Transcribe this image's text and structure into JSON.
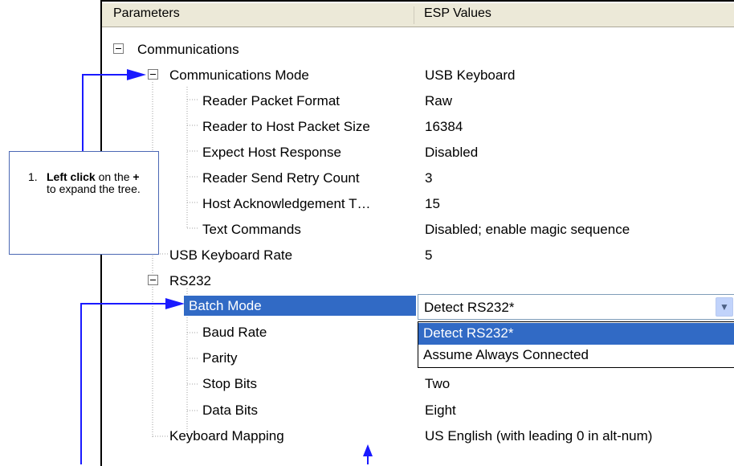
{
  "header": {
    "col_parameters": "Parameters",
    "col_values": "ESP Values"
  },
  "tree": {
    "communications": "Communications",
    "comm_mode": {
      "label": "Communications Mode",
      "value": "USB Keyboard"
    },
    "reader_packet_format": {
      "label": "Reader Packet Format",
      "value": "Raw"
    },
    "reader_host_packet_size": {
      "label": "Reader to Host Packet Size",
      "value": "16384"
    },
    "expect_host_response": {
      "label": "Expect Host Response",
      "value": "Disabled"
    },
    "reader_send_retry": {
      "label": "Reader Send Retry Count",
      "value": "3"
    },
    "host_ack": {
      "label": "Host Acknowledgement T…",
      "value": "15"
    },
    "text_commands": {
      "label": "Text Commands",
      "value": "Disabled; enable magic sequence"
    },
    "usb_keyboard_rate": {
      "label": "USB Keyboard Rate",
      "value": "5"
    },
    "rs232": "RS232",
    "batch_mode": {
      "label": "Batch Mode",
      "value": "Detect RS232*"
    },
    "baud_rate": {
      "label": "Baud Rate"
    },
    "parity": {
      "label": "Parity"
    },
    "stop_bits": {
      "label": "Stop Bits",
      "value": "Two"
    },
    "data_bits": {
      "label": "Data Bits",
      "value": "Eight"
    },
    "keyboard_mapping": {
      "label": "Keyboard Mapping",
      "value": "US English (with leading 0 in alt-num)"
    }
  },
  "dropdown_options": [
    "Detect RS232*",
    "Assume Always Connected"
  ],
  "callout": {
    "number": "1.",
    "bold": "Left click",
    "text_a": " on the ",
    "plus": "+",
    "text_b": " to expand the tree."
  },
  "colors": {
    "selection": "#316ac5",
    "arrow": "#1a1aff",
    "header_bg": "#ece9d8"
  }
}
